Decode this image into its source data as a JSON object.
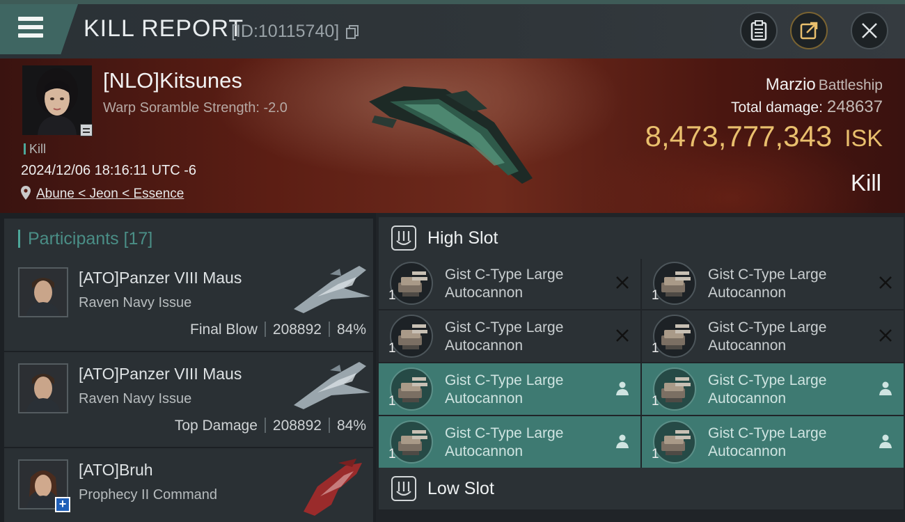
{
  "window": {
    "title": "KILL REPORT",
    "report_id": "[ID:10115740]"
  },
  "victim": {
    "name": "[NLO]Kitsunes",
    "warp_line": "Warp Soramble Strength: -2.0",
    "tag": "Kill",
    "timestamp": "2024/12/06 18:16:11 UTC -6",
    "location": "Abune < Jeon < Essence",
    "ship_name": "Marzio",
    "ship_class": "Battleship",
    "total_damage_label": "Total damage:",
    "total_damage": "248637",
    "isk_value": "8,473,777,343",
    "isk_unit": "ISK",
    "result": "Kill"
  },
  "participants": {
    "header": "Participants [17]",
    "items": [
      {
        "name": "[ATO]Panzer VIII Maus",
        "ship": "Raven Navy Issue",
        "role": "Final Blow",
        "damage": "208892",
        "percent": "84%"
      },
      {
        "name": "[ATO]Panzer VIII Maus",
        "ship": "Raven Navy Issue",
        "role": "Top Damage",
        "damage": "208892",
        "percent": "84%"
      },
      {
        "name": "[ATO]Bruh",
        "ship": "Prophecy II Command"
      }
    ]
  },
  "fitting": {
    "high_slot_label": "High Slot",
    "low_slot_label": "Low Slot",
    "high_modules": [
      {
        "line1": "Gist C-Type Large",
        "line2": "Autocannon",
        "qty": "1",
        "state": "destroyed"
      },
      {
        "line1": "Gist C-Type Large",
        "line2": "Autocannon",
        "qty": "1",
        "state": "destroyed"
      },
      {
        "line1": "Gist C-Type Large",
        "line2": "Autocannon",
        "qty": "1",
        "state": "destroyed"
      },
      {
        "line1": "Gist C-Type Large",
        "line2": "Autocannon",
        "qty": "1",
        "state": "destroyed"
      },
      {
        "line1": "Gist C-Type Large",
        "line2": "Autocannon",
        "qty": "1",
        "state": "dropped"
      },
      {
        "line1": "Gist C-Type Large",
        "line2": "Autocannon",
        "qty": "1",
        "state": "dropped"
      },
      {
        "line1": "Gist C-Type Large",
        "line2": "Autocannon",
        "qty": "1",
        "state": "dropped"
      },
      {
        "line1": "Gist C-Type Large",
        "line2": "Autocannon",
        "qty": "1",
        "state": "dropped"
      }
    ]
  },
  "colors": {
    "accent_teal": "#4da79a",
    "isk_gold": "#e9bf6d",
    "active_module": "#3e7a72"
  }
}
